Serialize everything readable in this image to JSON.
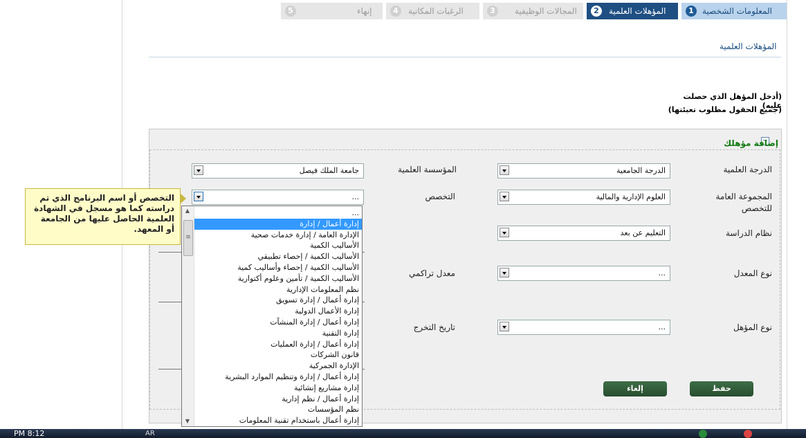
{
  "steps": [
    {
      "num": "1",
      "label": "المعلومات الشخصية",
      "state": "done"
    },
    {
      "num": "2",
      "label": "المؤهلات العلمية",
      "state": "active"
    },
    {
      "num": "3",
      "label": "المجالات الوظيفية",
      "state": "inactive"
    },
    {
      "num": "4",
      "label": "الرغبات المكانية",
      "state": "inactive"
    },
    {
      "num": "5",
      "label": "إنهاء",
      "state": "inactive"
    }
  ],
  "section_title": "المؤهلات العلمية",
  "hints": {
    "line1": "(أدخل المؤهل الذي حصلت عليه)",
    "line2": "(جميع الحقول مطلوب تعبئتها)"
  },
  "panel": {
    "title": "إضافة مؤهلك",
    "collapse_symbol": "−"
  },
  "labels": {
    "degree": "الدرجة العلمية",
    "institution": "المؤسسة العلمية",
    "general_group": "المجموعة العامة للتخصص",
    "specialization": "التخصص",
    "study_system": "نظام الدراسة",
    "gpa_type": "نوع المعدل",
    "gpa": "معدل تراكمي",
    "qualification_type": "نوع المؤهل",
    "graduation_date": "تاريخ التخرج"
  },
  "values": {
    "degree": "الدرجة الجامعية",
    "institution": "جامعة الملك فيصل",
    "general_group": "العلوم الإدارية والمالية",
    "specialization": "...",
    "study_system": "التعليم عن بعد",
    "gpa_type": "...",
    "qualification_type": "..."
  },
  "tooltip": "التخصص أو اسم البرنامج الذي تم دراسته كما هو مسجل في الشهادة العلمية الحاصل عليها من الجامعة أو المعهد.",
  "dropdown_options": [
    "...",
    "إدارة أعمال / إدارة",
    "الإدارة العامة / إدارة خدمات صحية",
    "الأساليب الكمية",
    "الأساليب الكمية / إحصاء تطبيقي",
    "الأساليب الكمية / إحصاء وأساليب كمية",
    "الأساليب الكمية / تأمين وعلوم أكتوارية",
    "نظم المعلومات الإدارية",
    "إدارة أعمال / إدارة تسويق",
    "إدارة الأعمال الدولية",
    "إدارة أعمال / إدارة المنشآت",
    "إدارة التقنية",
    "إدارة أعمال / إدارة العمليات",
    "قانون الشركات",
    "الإدارة الجمركية",
    "إدارة أعمال / إدارة وتنظيم الموارد البشرية",
    "إدارة مشاريع إنشائية",
    "إدارة أعمال / نظم إدارية",
    "نظم المؤسسات",
    "إدارة أعمال باستخدام تقنية المعلومات"
  ],
  "highlighted_option": 1,
  "buttons": {
    "save": "حفظ",
    "cancel": "إلغاء"
  },
  "taskbar": {
    "time": "PM 8:12",
    "lang": "AR"
  }
}
